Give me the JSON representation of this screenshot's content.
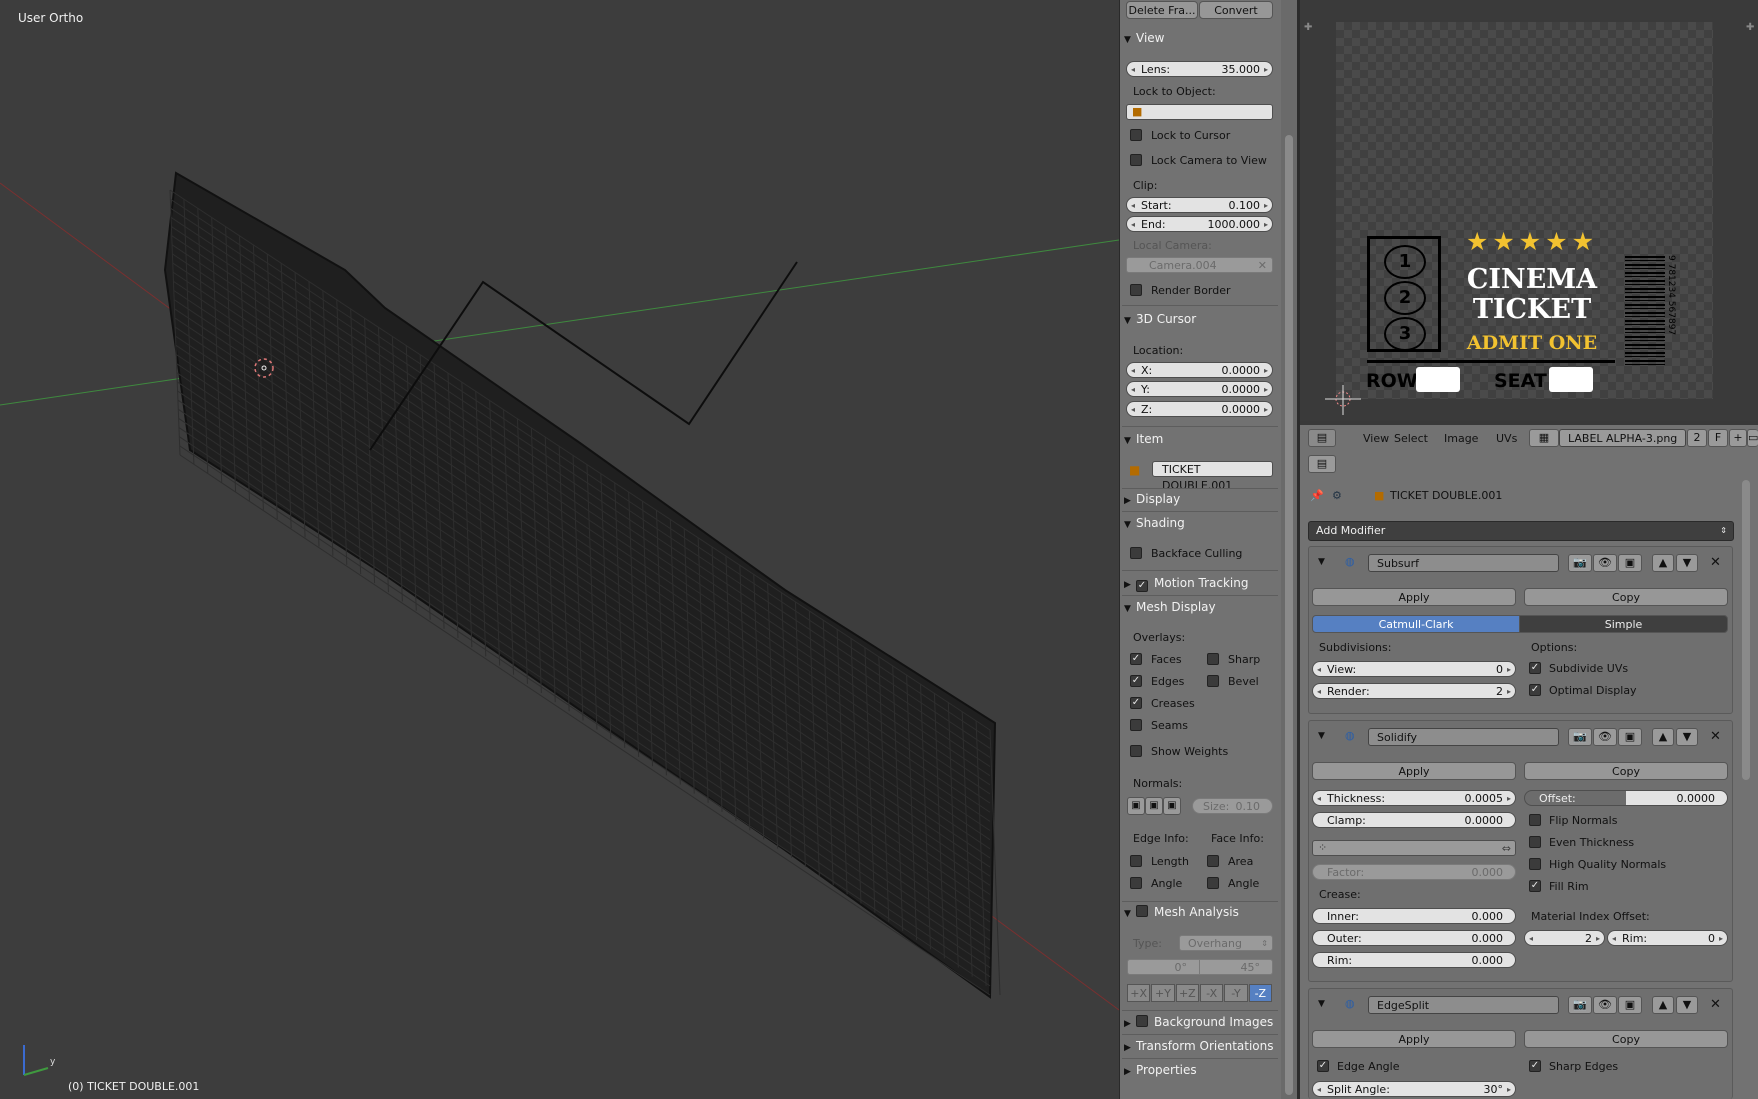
{
  "viewport": {
    "view_name": "User Ortho",
    "object_status": "(0) TICKET DOUBLE.001",
    "axis_y": "y"
  },
  "npanel": {
    "top_buttons": [
      "Delete Fra...",
      "Convert"
    ],
    "view": {
      "title": "View",
      "lens_label": "Lens:",
      "lens_value": "35.000",
      "lock_to_object": "Lock to Object:",
      "lock_to_cursor": "Lock to Cursor",
      "lock_camera": "Lock Camera to View",
      "clip": "Clip:",
      "start_label": "Start:",
      "start_value": "0.100",
      "end_label": "End:",
      "end_value": "1000.000",
      "local_camera": "Local Camera:",
      "camera_name": "Camera.004",
      "render_border": "Render Border"
    },
    "cursor": {
      "title": "3D Cursor",
      "location": "Location:",
      "x_label": "X:",
      "x_value": "0.0000",
      "y_label": "Y:",
      "y_value": "0.0000",
      "z_label": "Z:",
      "z_value": "0.0000"
    },
    "item": {
      "title": "Item",
      "name": "TICKET DOUBLE.001"
    },
    "display": {
      "title": "Display"
    },
    "shading": {
      "title": "Shading",
      "backface": "Backface Culling"
    },
    "motion_tracking": {
      "title": "Motion Tracking",
      "checked": true
    },
    "mesh_display": {
      "title": "Mesh Display",
      "overlays": "Overlays:",
      "faces": "Faces",
      "sharp": "Sharp",
      "edges": "Edges",
      "bevel": "Bevel",
      "creases": "Creases",
      "seams": "Seams",
      "show_weights": "Show Weights",
      "normals": "Normals:",
      "size_label": "Size:",
      "size_value": "0.10",
      "edge_info": "Edge Info:",
      "face_info": "Face Info:",
      "length": "Length",
      "area": "Area",
      "angle1": "Angle",
      "angle2": "Angle"
    },
    "mesh_analysis": {
      "title": "Mesh Analysis",
      "type_label": "Type:",
      "type_value": "Overhang",
      "min": "0°",
      "max": "45°",
      "axes": [
        "+X",
        "+Y",
        "+Z",
        "-X",
        "-Y",
        "-Z"
      ]
    },
    "background_images": "Background Images",
    "transform_orientations": "Transform Orientations",
    "properties": "Properties"
  },
  "image_editor": {
    "ticket": {
      "stars": "★★★★★",
      "line1": "CINEMA",
      "line2": "TICKET",
      "line3": "ADMIT ONE",
      "row": "ROW",
      "seat": "SEAT",
      "film_numbers": [
        "1",
        "2",
        "3"
      ],
      "barcode_number": "9 781234 567897"
    },
    "menu": [
      "View",
      "Select",
      "Image",
      "UVs"
    ],
    "image_name": "LABEL ALPHA-3.png",
    "users": "2",
    "fake": "F"
  },
  "properties": {
    "object_name": "TICKET DOUBLE.001",
    "add_modifier": "Add Modifier",
    "subsurf": {
      "name": "Subsurf",
      "apply": "Apply",
      "copy": "Copy",
      "tab_active": "Catmull-Clark",
      "tab_other": "Simple",
      "subdivisions": "Subdivisions:",
      "options": "Options:",
      "view_label": "View:",
      "view_value": "0",
      "render_label": "Render:",
      "render_value": "2",
      "subdivide_uvs": "Subdivide UVs",
      "optimal_display": "Optimal Display"
    },
    "solidify": {
      "name": "Solidify",
      "apply": "Apply",
      "copy": "Copy",
      "thickness_label": "Thickness:",
      "thickness_value": "0.0005",
      "offset_label": "Offset:",
      "offset_value": "0.0000",
      "clamp_label": "Clamp:",
      "clamp_value": "0.0000",
      "flip_normals": "Flip Normals",
      "even_thickness": "Even Thickness",
      "high_quality": "High Quality Normals",
      "fill_rim": "Fill Rim",
      "factor_label": "Factor:",
      "factor_value": "0.000",
      "crease": "Crease:",
      "inner_label": "Inner:",
      "inner_value": "0.000",
      "outer_label": "Outer:",
      "outer_value": "0.000",
      "rim_label": "Rim:",
      "rim_value": "0.000",
      "material_offset": "Material Index Offset:",
      "mat_value": "2",
      "mat_rim_label": "Rim:",
      "mat_rim_value": "0"
    },
    "edgesplit": {
      "name": "EdgeSplit",
      "apply": "Apply",
      "copy": "Copy",
      "edge_angle": "Edge Angle",
      "sharp_edges": "Sharp Edges",
      "split_angle_label": "Split Angle:",
      "split_angle_value": "30°"
    }
  }
}
